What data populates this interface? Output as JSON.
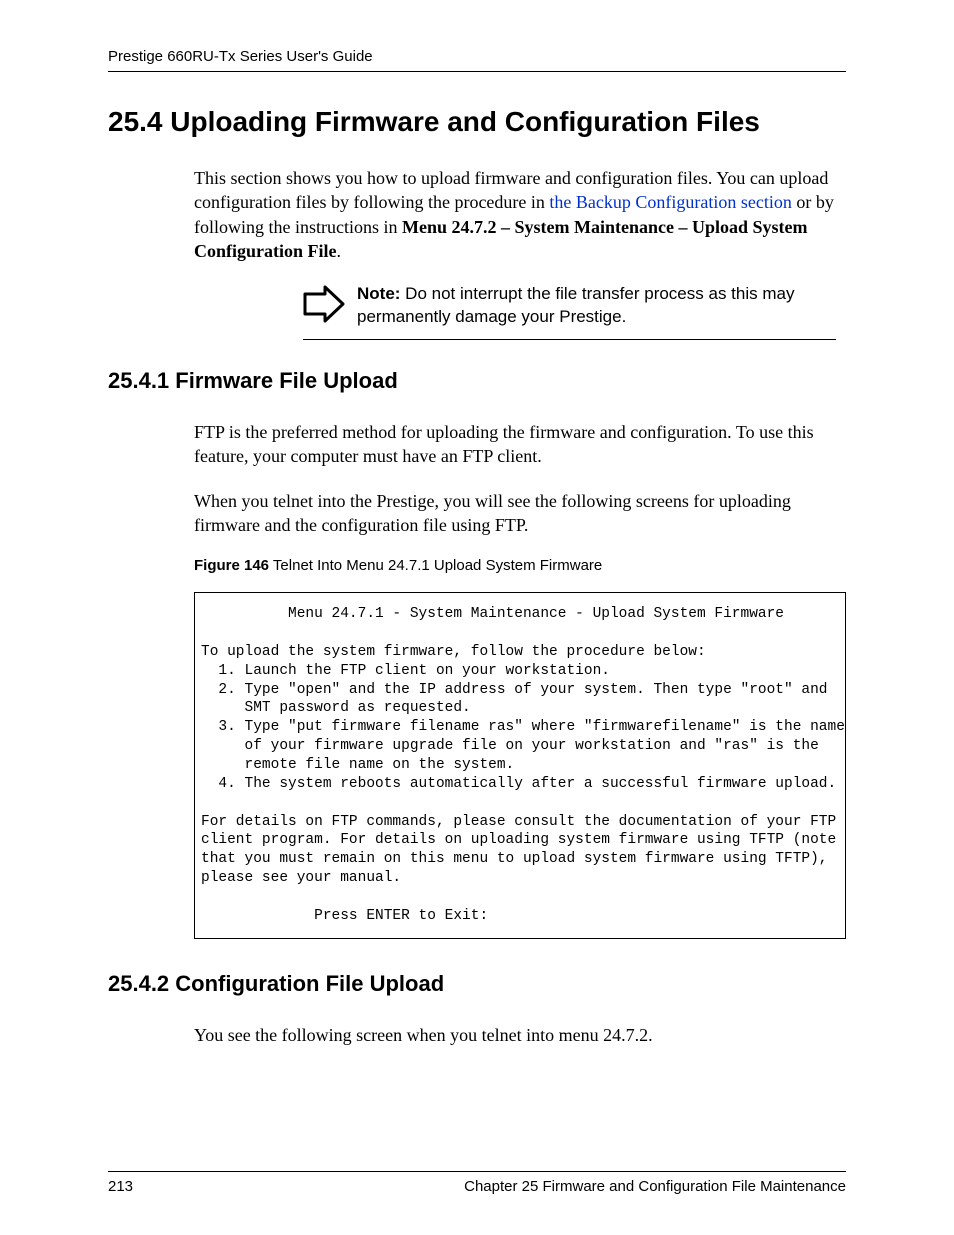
{
  "header": {
    "guide_title": "Prestige 660RU-Tx Series User's Guide"
  },
  "section_254": {
    "heading": "25.4  Uploading Firmware and Configuration Files",
    "para_lead": "This section shows you how to upload firmware and configuration files.  You can upload configuration files by following the procedure in ",
    "link_text": "the Backup Configuration section",
    "para_mid": " or by following the instructions in ",
    "bold_text": "Menu 24.7.2 – System Maintenance – Upload System Configuration File",
    "para_end": "."
  },
  "note": {
    "label": "Note:",
    "text": " Do not interrupt the file transfer process as this may permanently damage your Prestige."
  },
  "section_2541": {
    "heading": "25.4.1  Firmware File Upload",
    "para1": "FTP is the preferred method for uploading the firmware and configuration. To use this feature, your computer must have an FTP client.",
    "para2": "When you telnet into the Prestige, you will see the following screens for uploading firmware and the configuration file using FTP."
  },
  "figure146": {
    "label": "Figure 146",
    "title": "   Telnet Into Menu 24.7.1 Upload System Firmware",
    "code": "          Menu 24.7.1 - System Maintenance - Upload System Firmware\n\nTo upload the system firmware, follow the procedure below:\n  1. Launch the FTP client on your workstation.\n  2. Type \"open\" and the IP address of your system. Then type \"root\" and\n     SMT password as requested.\n  3. Type \"put firmware filename ras\" where \"firmwarefilename\" is the name\n     of your firmware upgrade file on your workstation and \"ras\" is the\n     remote file name on the system.\n  4. The system reboots automatically after a successful firmware upload.\n\nFor details on FTP commands, please consult the documentation of your FTP\nclient program. For details on uploading system firmware using TFTP (note\nthat you must remain on this menu to upload system firmware using TFTP),\nplease see your manual.\n\n             Press ENTER to Exit:"
  },
  "section_2542": {
    "heading": "25.4.2  Configuration File Upload",
    "para1": "You see the following screen when you telnet into menu 24.7.2."
  },
  "footer": {
    "page_number": "213",
    "chapter": "Chapter 25 Firmware and Configuration File Maintenance"
  }
}
